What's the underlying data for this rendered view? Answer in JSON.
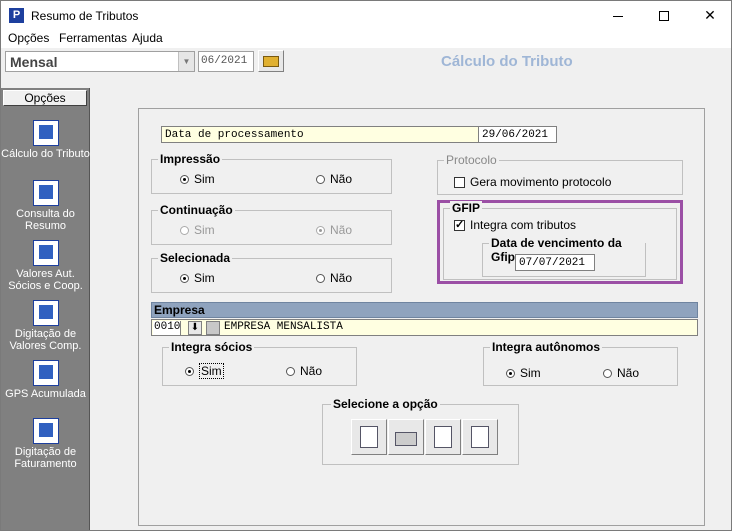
{
  "window": {
    "title": "Resumo de Tributos"
  },
  "menu": [
    "Opções",
    "Ferramentas",
    "Ajuda"
  ],
  "toolbar": {
    "period_value": "Mensal",
    "month_value": "06/2021",
    "heading": "Cálculo do Tributo"
  },
  "sidebar": {
    "header": "Opções",
    "items": [
      {
        "label": "Cálculo do Tributo",
        "icon": "calc-icon"
      },
      {
        "label": "Consulta do Resumo",
        "icon": "consult-icon"
      },
      {
        "label": "Valores Aut. Sócios e Coop.",
        "icon": "people-icon"
      },
      {
        "label": "Digitação de Valores Comp.",
        "icon": "doc-icon"
      },
      {
        "label": "GPS Acumulada",
        "icon": "gps-icon"
      },
      {
        "label": "Digitação de Faturamento",
        "icon": "book-icon"
      }
    ]
  },
  "form": {
    "processing_label": "Data de processamento",
    "processing_date": "29/06/2021",
    "impressao": {
      "title": "Impressão",
      "sim": "Sim",
      "nao": "Não",
      "selected": "Sim"
    },
    "continuacao": {
      "title": "Continuação",
      "sim": "Sim",
      "nao": "Não",
      "selected": "Não"
    },
    "selecionada": {
      "title": "Selecionada",
      "sim": "Sim",
      "nao": "Não",
      "selected": "Sim"
    },
    "protocolo": {
      "title": "Protocolo",
      "checkbox": "Gera movimento protocolo",
      "checked": false
    },
    "gfip": {
      "title": "GFIP",
      "checkbox": "Integra com tributos",
      "checked": true,
      "due_title": "Data de vencimento da Gfip",
      "due_date": "07/07/2021"
    },
    "empresa": {
      "title": "Empresa",
      "code": "0010",
      "name": "EMPRESA MENSALISTA"
    },
    "integra_socios": {
      "title": "Integra sócios",
      "sim": "Sim",
      "nao": "Não",
      "selected": "Sim"
    },
    "integra_autonomos": {
      "title": "Integra autônomos",
      "sim": "Sim",
      "nao": "Não",
      "selected": "Sim"
    },
    "selecione": {
      "title": "Selecione a opção"
    }
  },
  "colors": {
    "highlight": "#9b4fa5",
    "heading": "#9fb6d6",
    "yellow_field": "#ffffe1"
  }
}
